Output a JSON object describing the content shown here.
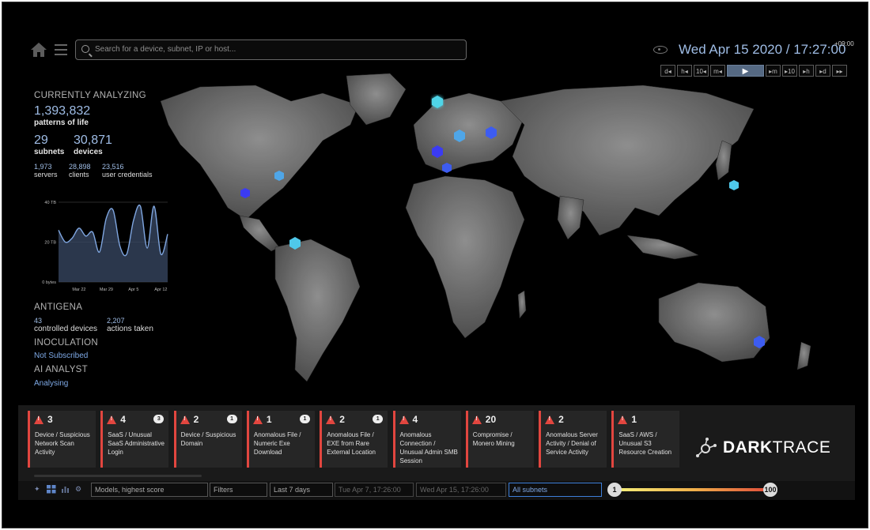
{
  "header": {
    "search_placeholder": "Search for a device, subnet, IP or host...",
    "datetime": "Wed Apr 15 2020 / 17:27:00",
    "timezone": "+09:00",
    "time_controls": [
      "d◂",
      "h◂",
      "10◂",
      "m◂",
      "▶",
      "▸m",
      "▸10",
      "▸h",
      "▸d",
      "▸▸"
    ]
  },
  "stats": {
    "analyzing_heading": "CURRENTLY ANALYZING",
    "patterns_value": "1,393,832",
    "patterns_label": "patterns of life",
    "subnets_value": "29",
    "subnets_label": "subnets",
    "devices_value": "30,871",
    "devices_label": "devices",
    "servers_value": "1,973",
    "servers_label": "servers",
    "clients_value": "28,898",
    "clients_label": "clients",
    "creds_value": "23,516",
    "creds_label": "user credentials",
    "antigena_heading": "ANTIGENA",
    "controlled_value": "43",
    "controlled_label": "controlled devices",
    "actions_value": "2,207",
    "actions_label": "actions taken",
    "inoculation_heading": "INOCULATION",
    "inoculation_status": "Not Subscribed",
    "ai_heading": "AI ANALYST",
    "ai_status": "Analysing"
  },
  "chart_data": {
    "type": "area",
    "x": [
      "Mar 17",
      "Mar 19",
      "Mar 21",
      "Mar 22",
      "Mar 24",
      "Mar 26",
      "Mar 28",
      "Mar 29",
      "Mar 31",
      "Apr 2",
      "Apr 4",
      "Apr 5",
      "Apr 7",
      "Apr 9",
      "Apr 11",
      "Apr 12",
      "Apr 14"
    ],
    "values": [
      26,
      20,
      22,
      27,
      23,
      25,
      15,
      32,
      36,
      18,
      14,
      31,
      38,
      17,
      38,
      14,
      24
    ],
    "ylim": [
      0,
      40
    ],
    "y_tick_labels": [
      "40 TB",
      "20 TB",
      "0 bytes"
    ],
    "x_tick_labels": [
      "Mar 22",
      "Mar 29",
      "Apr 5",
      "Apr 12"
    ],
    "grid": true
  },
  "breaches": [
    {
      "score": "3",
      "title": "Device / Suspicious Network Scan Activity",
      "comments": ""
    },
    {
      "score": "4",
      "title": "SaaS / Unusual SaaS Administrative Login",
      "comments": "3"
    },
    {
      "score": "2",
      "title": "Device / Suspicious Domain",
      "comments": "1"
    },
    {
      "score": "1",
      "title": "Anomalous File / Numeric Exe Download",
      "comments": "1"
    },
    {
      "score": "2",
      "title": "Anomalous File / EXE from Rare External Location",
      "comments": "1"
    },
    {
      "score": "4",
      "title": "Anomalous Connection / Unusual Admin SMB Session",
      "comments": ""
    },
    {
      "score": "20",
      "title": "Compromise / Monero Mining",
      "comments": ""
    },
    {
      "score": "2",
      "title": "Anomalous Server Activity / Denial of Service Activity",
      "comments": ""
    },
    {
      "score": "1",
      "title": "SaaS / AWS / Unusual S3 Resource Creation",
      "comments": ""
    }
  ],
  "logo": {
    "bold": "DARK",
    "light": "TRACE"
  },
  "filters": {
    "sort": "Models, highest score",
    "filters": "Filters",
    "range": "Last 7 days",
    "from": "Tue Apr 7, 17:26:00",
    "to": "Wed Apr 15, 17:26:00",
    "subnets": "All subnets",
    "slider_min": "1",
    "slider_max": "100"
  },
  "colors": {
    "accent": "#9fbde6",
    "alert": "#e2463f",
    "marker": "#4fd5e8"
  }
}
